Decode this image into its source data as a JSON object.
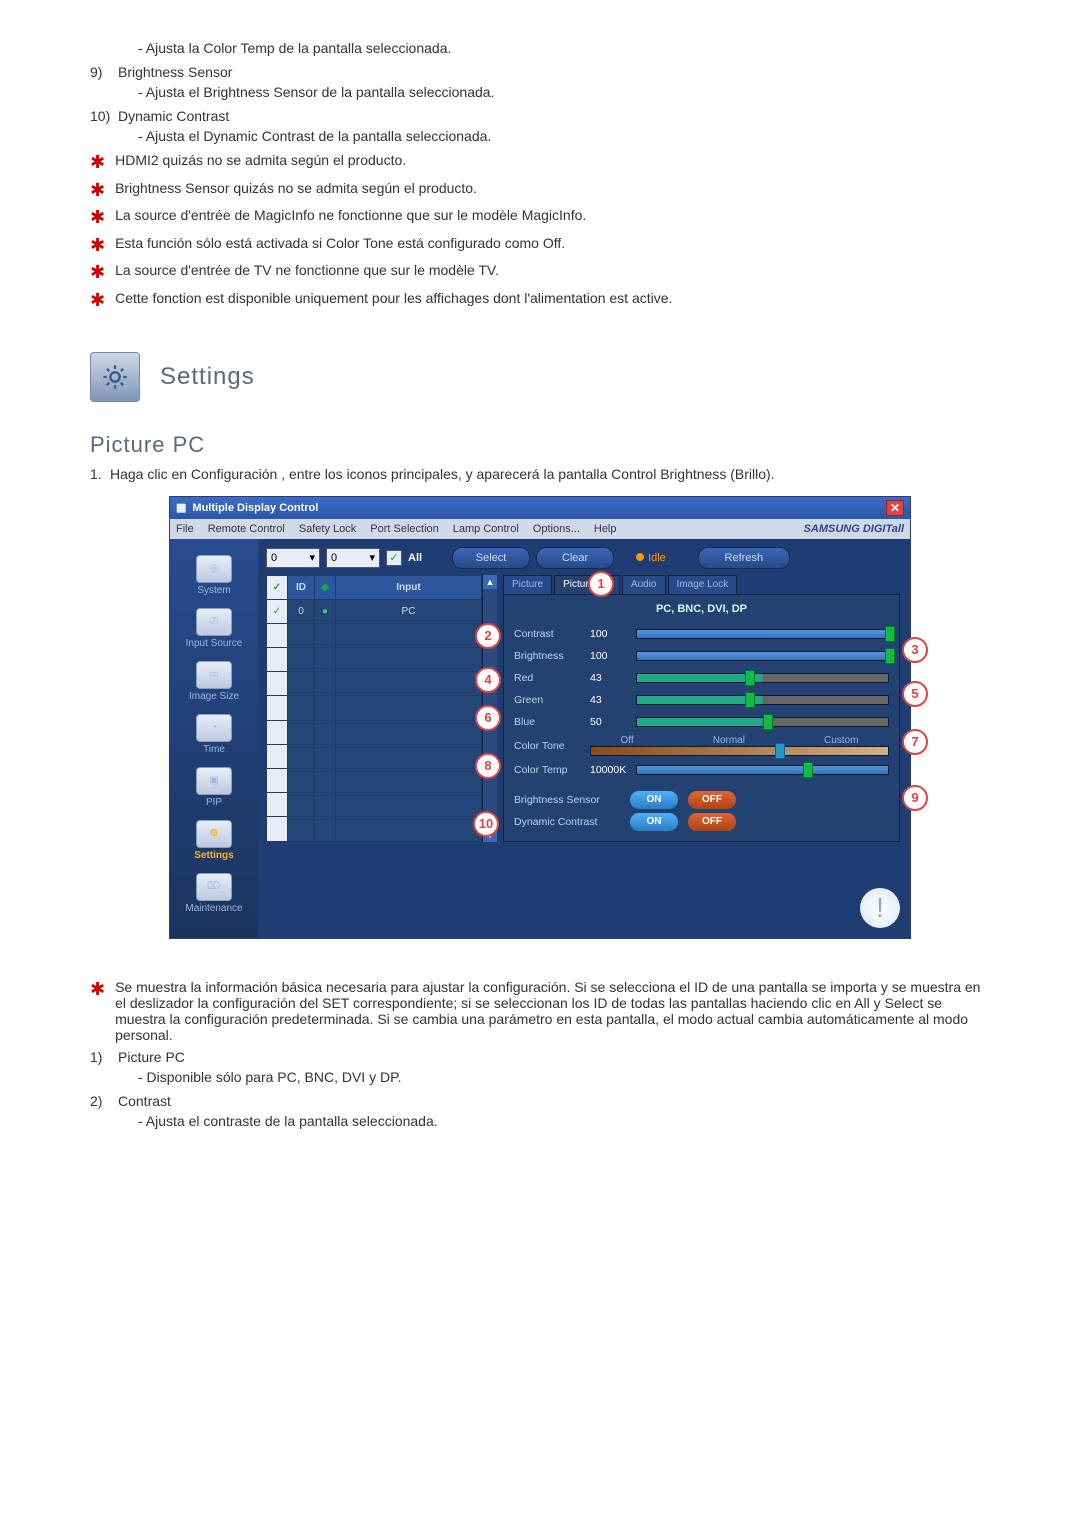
{
  "top_items": [
    {
      "num": "",
      "title": "",
      "desc": "- Ajusta la Color Temp de la pantalla seleccionada."
    },
    {
      "num": "9)",
      "title": "Brightness Sensor",
      "desc": "- Ajusta el Brightness Sensor de la pantalla seleccionada."
    },
    {
      "num": "10)",
      "title": "Dynamic Contrast",
      "desc": "- Ajusta el Dynamic Contrast de la pantalla seleccionada."
    }
  ],
  "notes_top": [
    "HDMI2 quizás no se admita según el producto.",
    "Brightness Sensor quizás no se admita según el producto.",
    "La source d'entrée de MagicInfo ne fonctionne que sur le modèle MagicInfo.",
    "Esta función sólo está activada si Color Tone está configurado como Off.",
    "La source d'entrée de TV ne fonctionne que sur le modèle TV.",
    "Cette fonction est disponible uniquement pour les affichages dont l'alimentation est active."
  ],
  "settings_heading": "Settings",
  "section_heading": "Picture PC",
  "intro": {
    "num": "1.",
    "text": "Haga clic en Configuración , entre los iconos principales, y aparecerá la pantalla Control Brightness (Brillo)."
  },
  "app": {
    "title": "Multiple Display Control",
    "menus": [
      "File",
      "Remote Control",
      "Safety Lock",
      "Port Selection",
      "Lamp Control",
      "Options...",
      "Help"
    ],
    "brand": "SAMSUNG DIGITall",
    "sidebar": [
      {
        "label": "System"
      },
      {
        "label": "Input Source"
      },
      {
        "label": "Image Size"
      },
      {
        "label": "Time"
      },
      {
        "label": "PIP"
      },
      {
        "label": "Settings",
        "active": true
      },
      {
        "label": "Maintenance"
      }
    ],
    "dd1": "0",
    "dd2": "0",
    "all_label": "All",
    "select_btn": "Select",
    "clear_btn": "Clear",
    "idle_label": "Idle",
    "refresh_btn": "Refresh",
    "table": {
      "headers": [
        "",
        "ID",
        "",
        "Input"
      ],
      "rows": [
        {
          "chk": "✓",
          "id": "0",
          "stat": "●",
          "input": "PC"
        },
        {
          "chk": "",
          "id": "",
          "stat": "",
          "input": ""
        },
        {
          "chk": "",
          "id": "",
          "stat": "",
          "input": ""
        },
        {
          "chk": "",
          "id": "",
          "stat": "",
          "input": ""
        },
        {
          "chk": "",
          "id": "",
          "stat": "",
          "input": ""
        },
        {
          "chk": "",
          "id": "",
          "stat": "",
          "input": ""
        },
        {
          "chk": "",
          "id": "",
          "stat": "",
          "input": ""
        },
        {
          "chk": "",
          "id": "",
          "stat": "",
          "input": ""
        },
        {
          "chk": "",
          "id": "",
          "stat": "",
          "input": ""
        },
        {
          "chk": "",
          "id": "",
          "stat": "",
          "input": ""
        }
      ]
    },
    "tabs": [
      "Picture",
      "Picture PC",
      "Audio",
      "Image Lock"
    ],
    "panel_title": "PC, BNC, DVI, DP",
    "controls": {
      "contrast": {
        "label": "Contrast",
        "value": "100"
      },
      "brightness": {
        "label": "Brightness",
        "value": "100"
      },
      "red": {
        "label": "Red",
        "value": "43"
      },
      "green": {
        "label": "Green",
        "value": "43"
      },
      "blue": {
        "label": "Blue",
        "value": "50"
      },
      "tone": {
        "label": "Color Tone",
        "opts": [
          "Off",
          "Normal",
          "Custom"
        ]
      },
      "temp": {
        "label": "Color Temp",
        "value": "10000K"
      },
      "bsensor": {
        "label": "Brightness Sensor",
        "on": "ON",
        "off": "OFF"
      },
      "dcontrast": {
        "label": "Dynamic Contrast",
        "on": "ON",
        "off": "OFF"
      }
    },
    "badges": {
      "b1": "1",
      "b2": "2",
      "b3": "3",
      "b4": "4",
      "b5": "5",
      "b6": "6",
      "b7": "7",
      "b8": "8",
      "b9": "9",
      "b10": "10"
    }
  },
  "footnote": "Se muestra la información básica necesaria para ajustar la configuración. Si se selecciona el ID de una pantalla se importa y se muestra en el deslizador la configuración del SET correspondiente; si se seleccionan los ID de todas las pantallas haciendo clic en All y Select se muestra la configuración predeterminada. Si se cambia una parámetro en esta pantalla, el modo actual cambia automáticamente al modo personal.",
  "bottom_items": [
    {
      "num": "1)",
      "title": "Picture PC",
      "desc": "- Disponible sólo para PC, BNC, DVI y DP."
    },
    {
      "num": "2)",
      "title": "Contrast",
      "desc": "- Ajusta el contraste de la pantalla seleccionada."
    }
  ]
}
